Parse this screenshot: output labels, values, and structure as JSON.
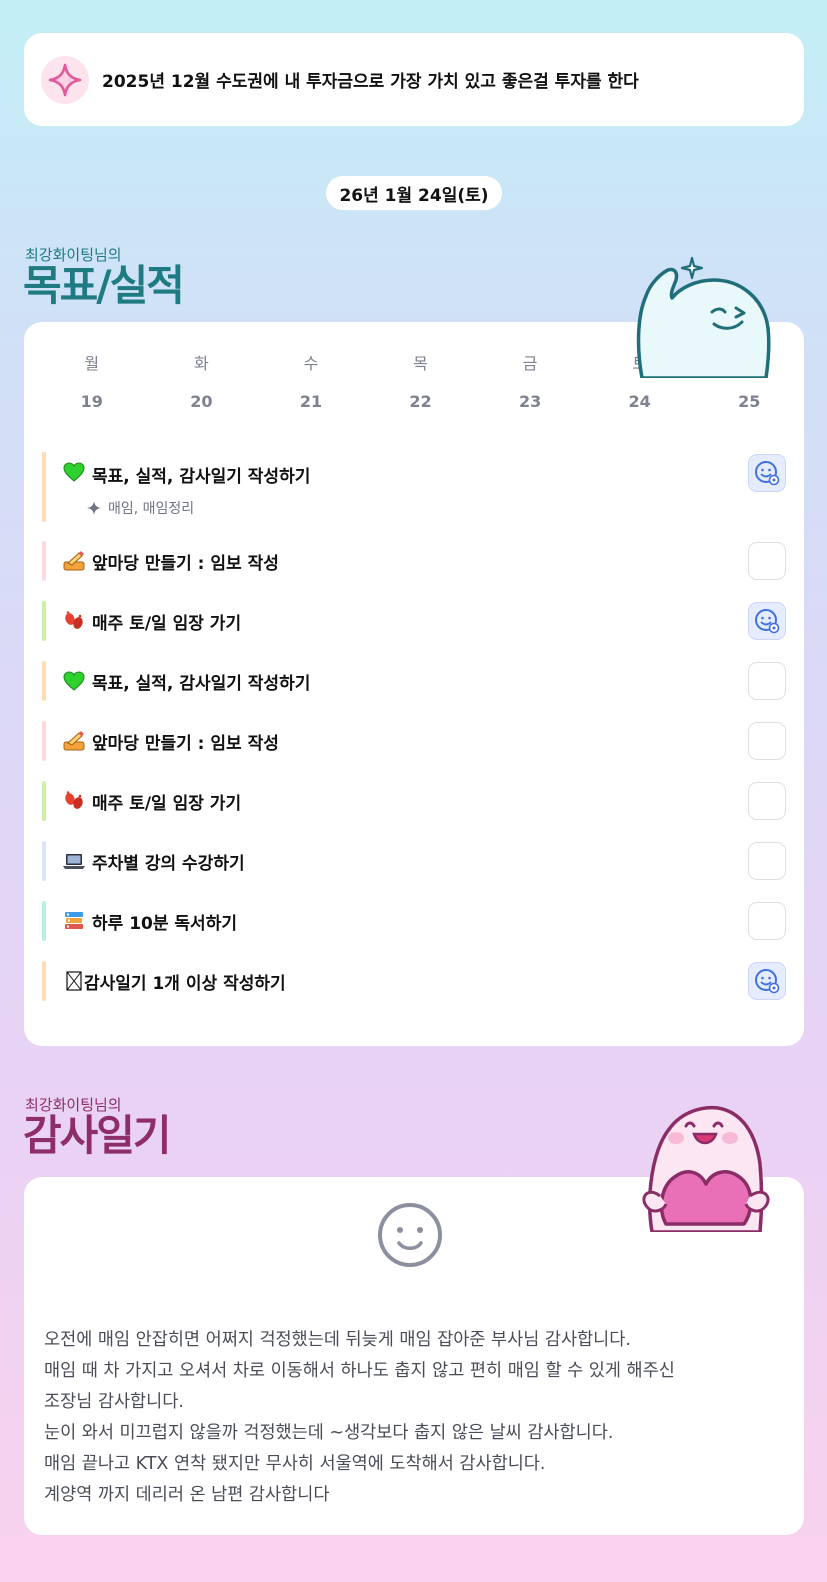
{
  "goal_banner": {
    "icon": "sparkle-icon",
    "text": "2025년 12월 수도권에 내 투자금으로 가장 가치 있고 좋은걸 투자를 한다"
  },
  "date": "26년 1월 24일(토)",
  "goals_section": {
    "subtitle": "최강화이팅님의",
    "title": "목표/실적"
  },
  "week": {
    "days": [
      "월",
      "화",
      "수",
      "목",
      "금",
      "토",
      "일"
    ],
    "dates": [
      "19",
      "20",
      "21",
      "22",
      "23",
      "24",
      "25"
    ]
  },
  "tasks": [
    {
      "label": "목표, 실적, 감사일기 작성하기",
      "icon": "heart-icon",
      "checked": true,
      "bar_color": "#ffdcb2",
      "sub": "매임, 매임정리"
    },
    {
      "label": "앞마당 만들기 : 임보 작성",
      "icon": "writing-hand-icon",
      "checked": false,
      "bar_color": "#ffd9de"
    },
    {
      "label": "매주 토/일 임장 가기",
      "icon": "footprints-icon",
      "checked": true,
      "bar_color": "#cdf0a5"
    },
    {
      "label": "목표, 실적, 감사일기 작성하기",
      "icon": "heart-icon",
      "checked": false,
      "bar_color": "#ffdcb2"
    },
    {
      "label": "앞마당 만들기 : 임보 작성",
      "icon": "writing-hand-icon",
      "checked": false,
      "bar_color": "#ffd9de"
    },
    {
      "label": "매주 토/일 임장 가기",
      "icon": "footprints-icon",
      "checked": false,
      "bar_color": "#cdf0a5"
    },
    {
      "label": "주차별 강의 수강하기",
      "icon": "laptop-icon",
      "checked": false,
      "bar_color": "#d9e5fb"
    },
    {
      "label": "하루 10분 독서하기",
      "icon": "books-icon",
      "checked": false,
      "bar_color": "#b9f0dc"
    },
    {
      "label": "감사일기 1개 이상 작성하기",
      "icon": "missing-glyph-icon",
      "checked": true,
      "bar_color": "#ffdcb2"
    }
  ],
  "diary_section": {
    "subtitle": "최강화이팅님의",
    "title": "감사일기"
  },
  "diary": {
    "mood_icon": "smile-face-icon",
    "lines": [
      "오전에 매임 안잡히면 어쩌지 걱정했는데 뒤늦게 매임 잡아준 부사님 감사합니다.",
      "매임 때 차 가지고 오셔서 차로 이동해서 하나도 춥지 않고 편히 매임 할 수 있게 해주신",
      "조장님 감사합니다.",
      "눈이 와서 미끄럽지 않을까 걱정했는데 ~생각보다 춥지 않은 날씨 감사합니다.",
      "매임 끝나고 KTX 연착 됐지만 무사히 서울역에 도착해서 감사합니다.",
      "계양역 까지 데리러 온 남편 감사합니다"
    ]
  },
  "colors": {
    "goals_title": "#1f7b82",
    "diary_title": "#8e2e67",
    "check_done_bg": "#e5ecff",
    "check_done_icon": "#3f6fe0"
  }
}
